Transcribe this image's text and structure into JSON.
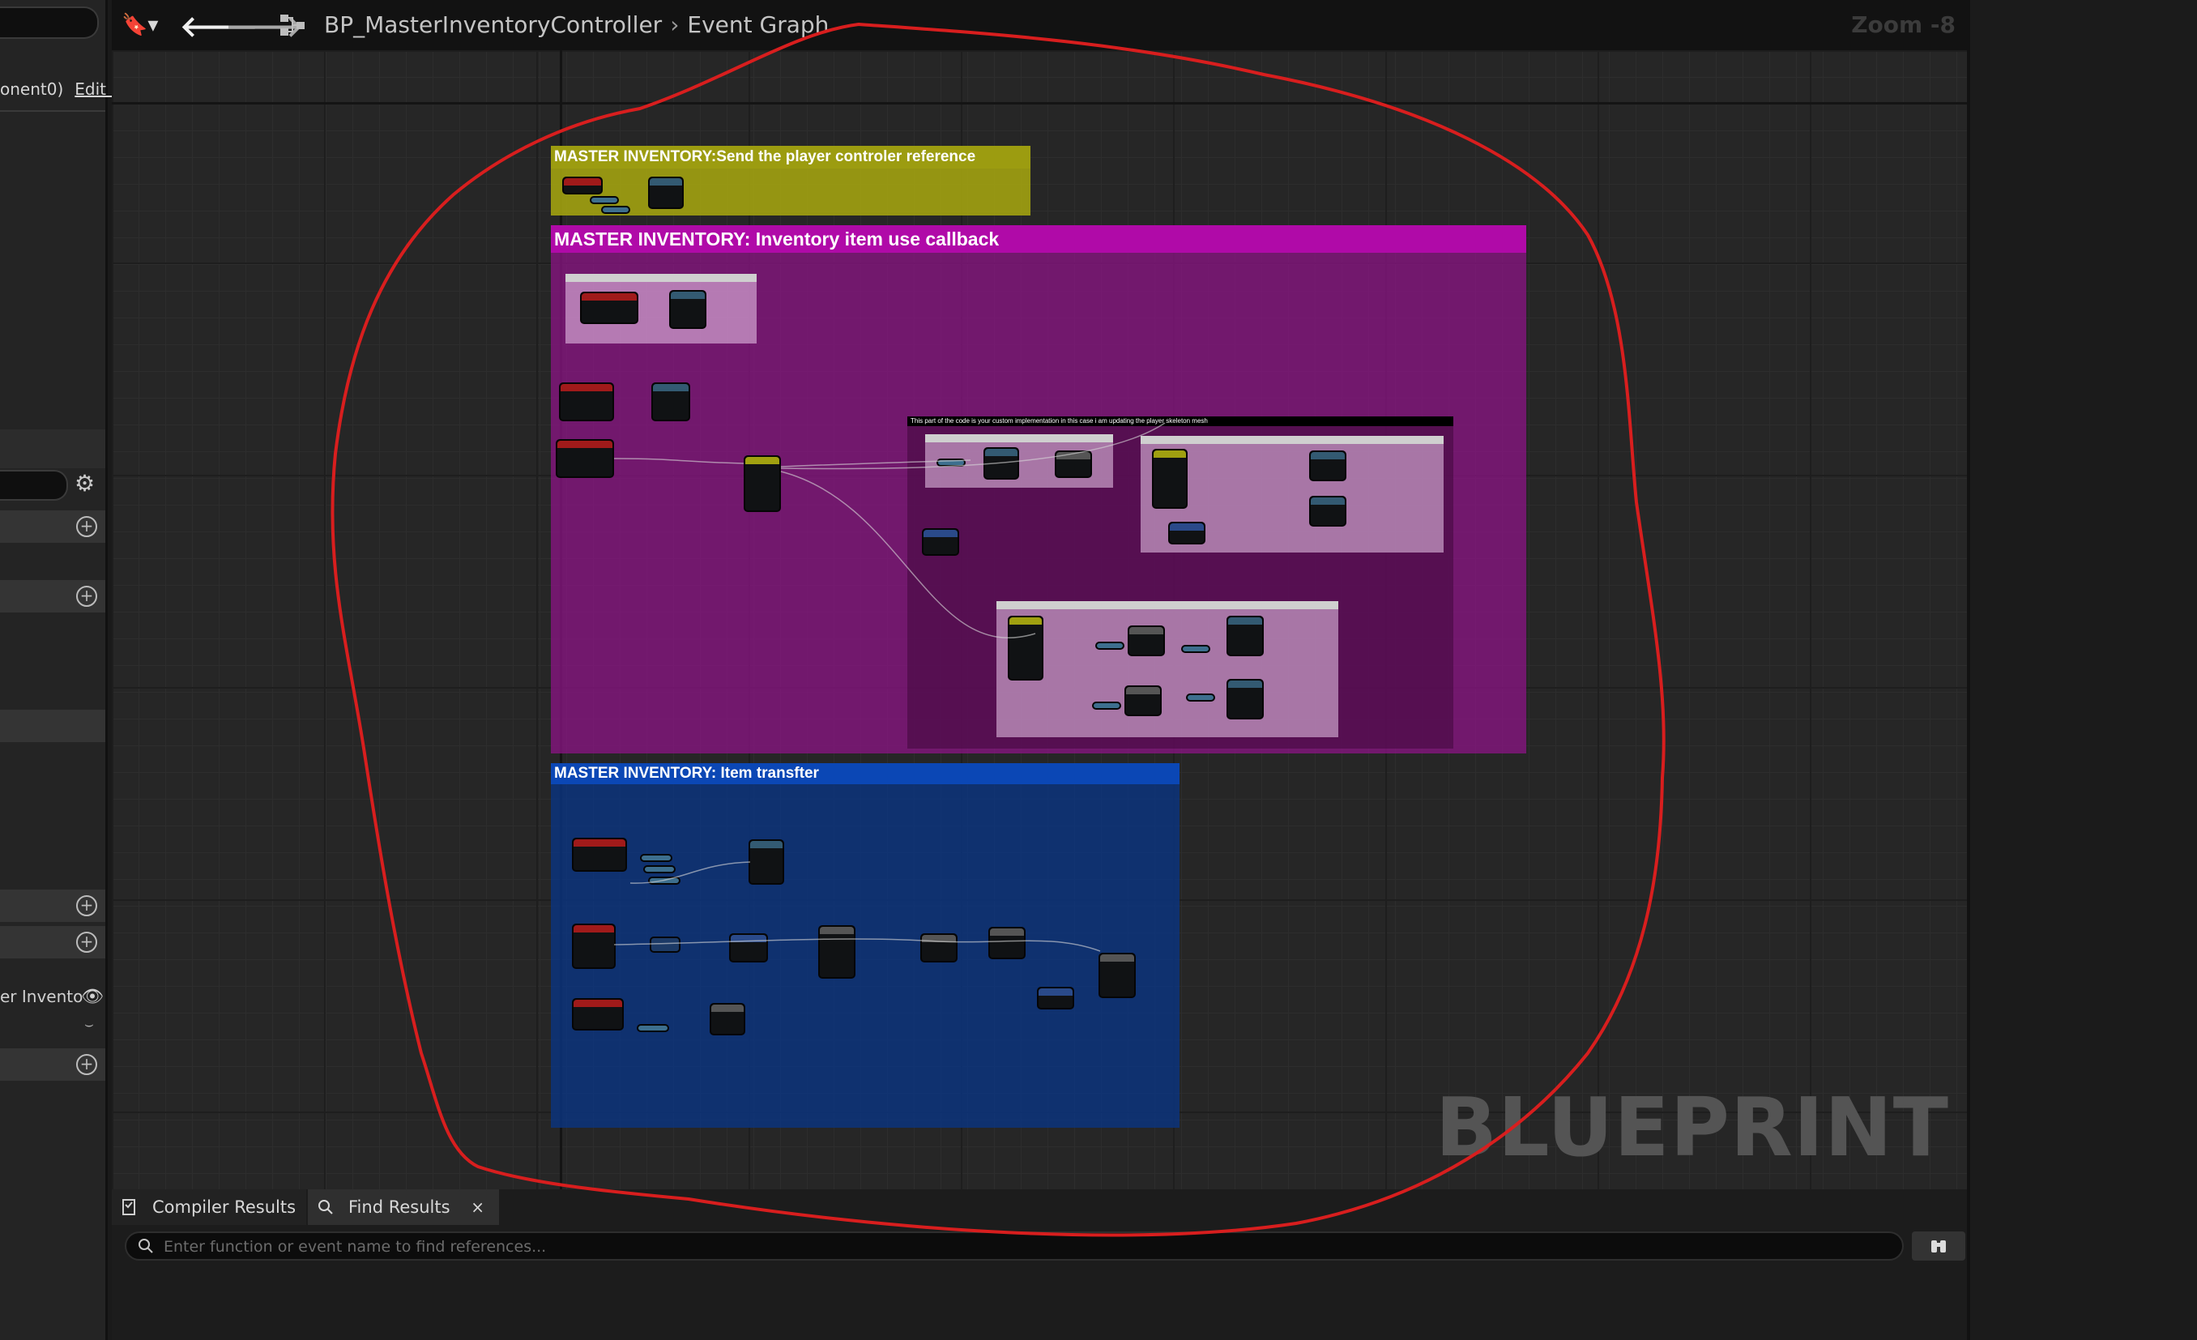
{
  "breadcrumb": {
    "blueprint": "BP_MasterInventoryController",
    "graph": "Event Graph",
    "zoom": "Zoom -8"
  },
  "left_panel": {
    "component_label": "onent0)",
    "edit_label": "Edit i",
    "variable_label": "er Invento"
  },
  "comments": {
    "send_ref": "MASTER INVENTORY:Send the player controler reference",
    "use_callback": "MASTER INVENTORY: Inventory item use callback",
    "custom_impl_note": "This part of the code is your custom implementation in this case i am updating the player skeleton mesh",
    "item_transfer": "MASTER INVENTORY: Item transfter"
  },
  "colors": {
    "send_ref": "#a9a90f",
    "use_callback": "#9a0e96",
    "item_transfer": "#0a3f9c",
    "annotation": "#d81e1e"
  },
  "watermark": "BLUEPRINT",
  "bottom_panel": {
    "tabs": [
      "Compiler Results",
      "Find Results"
    ],
    "close_glyph": "×",
    "find_placeholder": "Enter function or event name to find references..."
  }
}
